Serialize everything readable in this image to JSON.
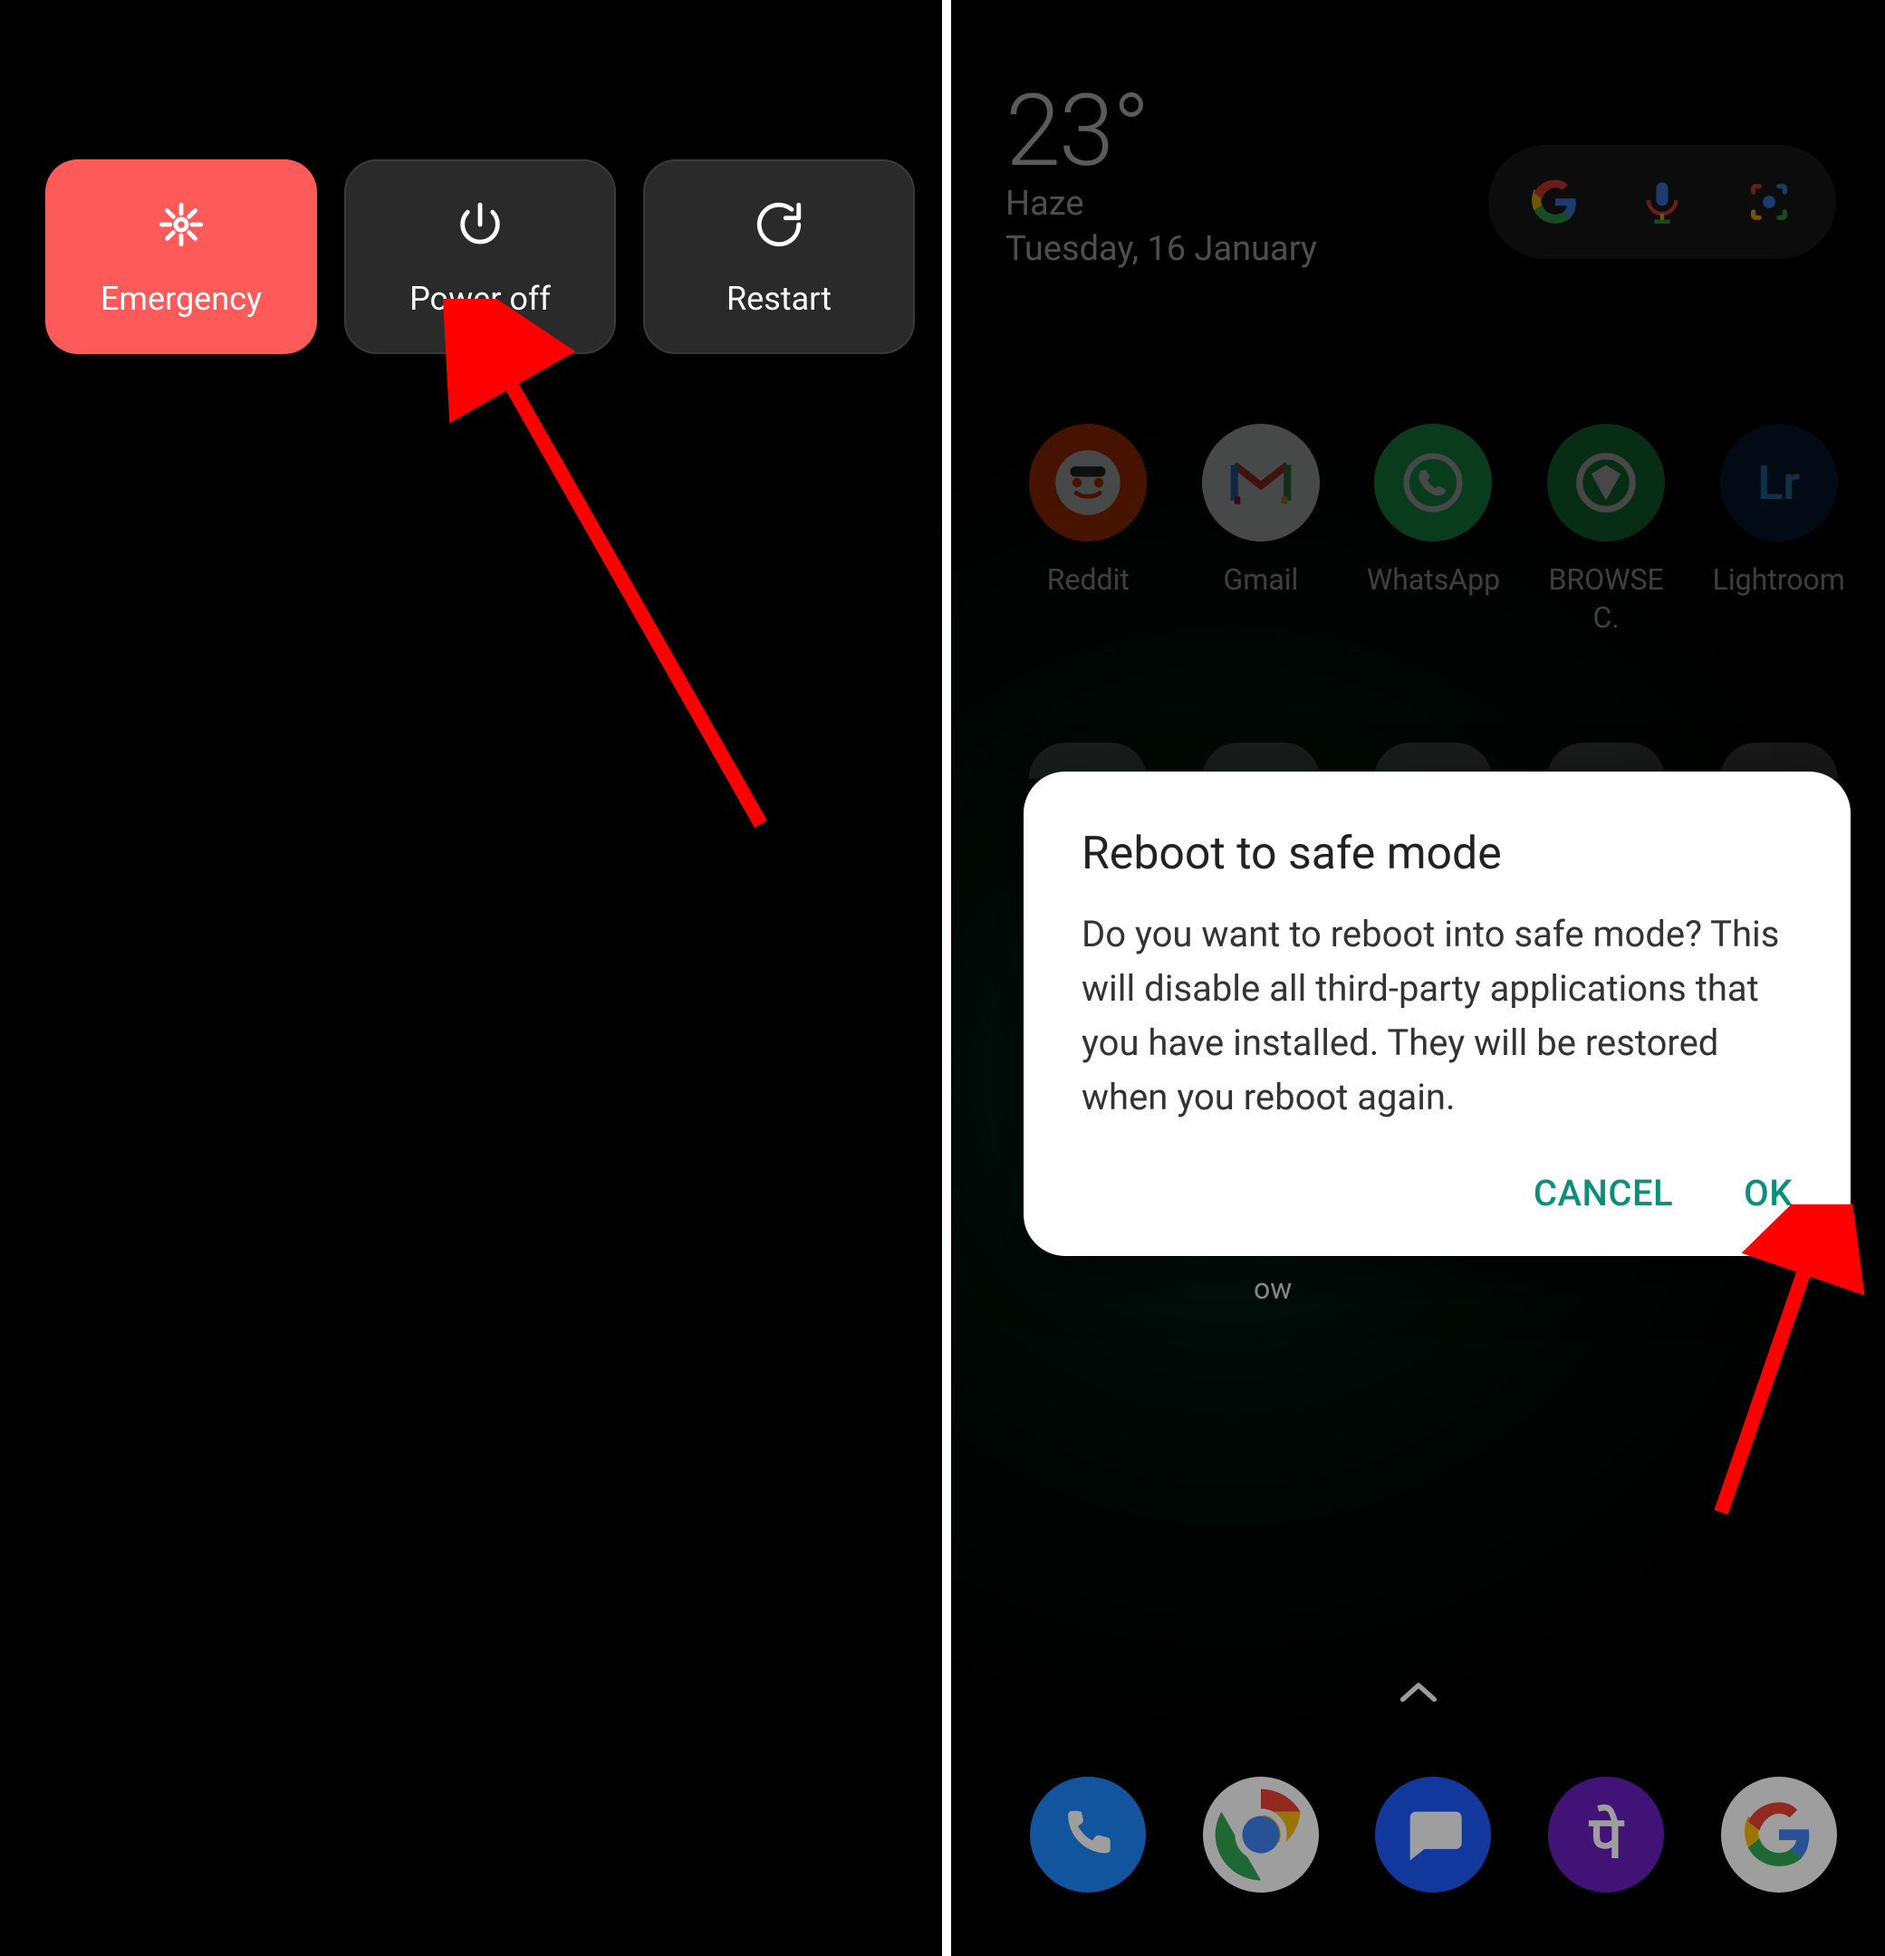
{
  "left_panel": {
    "emergency_label": "Emergency",
    "power_off_label": "Power off",
    "restart_label": "Restart"
  },
  "right_panel": {
    "weather": {
      "temperature": "23°",
      "condition": "Haze",
      "date": "Tuesday, 16 January"
    },
    "search": {
      "logo_name": "google-logo-icon",
      "mic_name": "mic-icon",
      "lens_name": "lens-icon"
    },
    "apps": [
      {
        "name": "Reddit",
        "bg": "#ff4500",
        "glyph": "😎"
      },
      {
        "name": "Gmail",
        "bg": "#ffffff",
        "glyph": "M"
      },
      {
        "name": "WhatsApp",
        "bg": "#25d366",
        "glyph": "📞"
      },
      {
        "name": "BROWSE\nC.",
        "bg": "#1aa34a",
        "glyph": "▽"
      },
      {
        "name": "Lightroom",
        "bg": "#0a2a4d",
        "glyph": "Lr"
      }
    ],
    "dialog": {
      "title": "Reboot to safe mode",
      "body": "Do you want to reboot into safe mode? This will disable all third-party applications that you have installed. They will be restored when you reboot again.",
      "cancel_label": "CANCEL",
      "ok_label": "OK"
    },
    "fragment_below_dialog": "ow",
    "dock": [
      {
        "name": "Phone",
        "bg": "#1e88ff"
      },
      {
        "name": "Chrome",
        "bg": "#ffffff"
      },
      {
        "name": "Messages",
        "bg": "#1e5bff"
      },
      {
        "name": "PhonePe",
        "bg": "#6a1fbf"
      },
      {
        "name": "Google",
        "bg": "#ffffff"
      }
    ]
  }
}
